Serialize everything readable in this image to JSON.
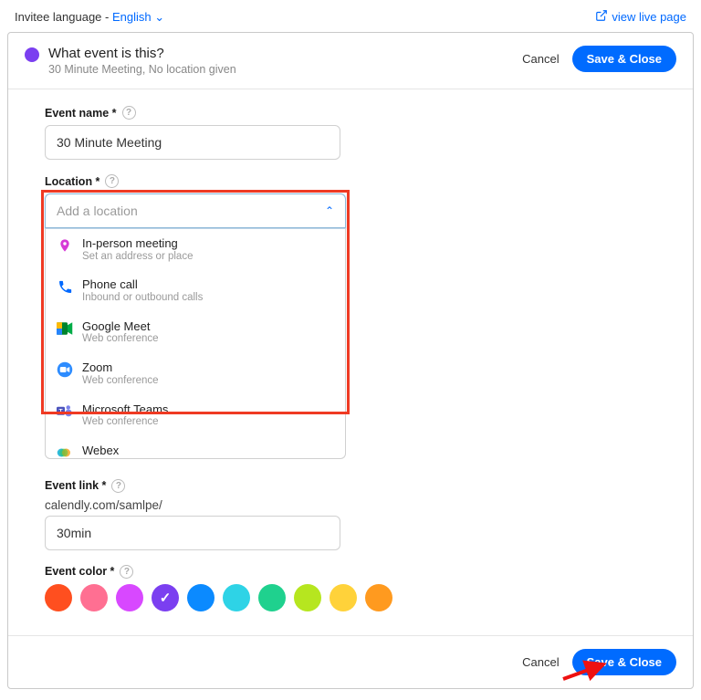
{
  "topbar": {
    "invitee_label": "Invitee language - ",
    "language": "English",
    "live_link": "view live page"
  },
  "header": {
    "title": "What event is this?",
    "subtitle": "30 Minute Meeting, No location given",
    "cancel": "Cancel",
    "save": "Save & Close"
  },
  "fields": {
    "event_name_label": "Event name *",
    "event_name_value": "30 Minute Meeting",
    "location_label": "Location *",
    "location_placeholder": "Add a location",
    "event_link_label": "Event link *",
    "event_link_prefix": "calendly.com/samlpe/",
    "event_link_value": "30min",
    "event_color_label": "Event color *"
  },
  "location_options": [
    {
      "title": "In-person meeting",
      "desc": "Set an address or place",
      "icon": "pin",
      "color": "#d63ad6"
    },
    {
      "title": "Phone call",
      "desc": "Inbound or outbound calls",
      "icon": "phone",
      "color": "#0069ff"
    },
    {
      "title": "Google Meet",
      "desc": "Web conference",
      "icon": "gmeet",
      "color": "#00832d"
    },
    {
      "title": "Zoom",
      "desc": "Web conference",
      "icon": "zoom",
      "color": "#2d8cff"
    },
    {
      "title": "Microsoft Teams",
      "desc": "Web conference",
      "icon": "teams",
      "color": "#4b53bc"
    },
    {
      "title": "Webex",
      "desc": "",
      "icon": "webex",
      "color": "#1ab4d7"
    }
  ],
  "colors": [
    {
      "hex": "#ff4f1f",
      "selected": false
    },
    {
      "hex": "#ff6f92",
      "selected": false
    },
    {
      "hex": "#d848ff",
      "selected": false
    },
    {
      "hex": "#7b3ff0",
      "selected": true
    },
    {
      "hex": "#0b8aff",
      "selected": false
    },
    {
      "hex": "#2ed3e6",
      "selected": false
    },
    {
      "hex": "#1fd18e",
      "selected": false
    },
    {
      "hex": "#b6e61f",
      "selected": false
    },
    {
      "hex": "#ffd23a",
      "selected": false
    },
    {
      "hex": "#ff9a1f",
      "selected": false
    }
  ],
  "footer": {
    "cancel": "Cancel",
    "save": "Save & Close"
  }
}
